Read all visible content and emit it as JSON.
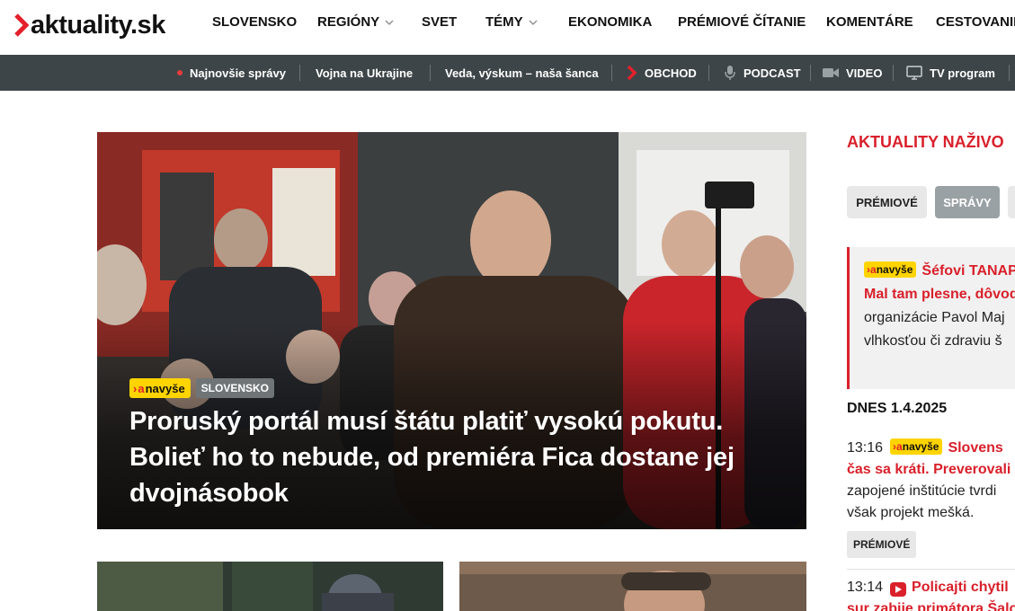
{
  "logo": {
    "text": "aktuality.sk"
  },
  "nav": {
    "items": [
      {
        "label": "SLOVENSKO",
        "dropdown": false
      },
      {
        "label": "REGIÓNY",
        "dropdown": true
      },
      {
        "label": "SVET",
        "dropdown": false
      },
      {
        "label": "TÉMY",
        "dropdown": true
      },
      {
        "label": "EKONOMIKA",
        "dropdown": false
      },
      {
        "label": "PRÉMIOVÉ ČÍTANIE",
        "dropdown": false
      },
      {
        "label": "KOMENTÁRE",
        "dropdown": false
      },
      {
        "label": "CESTOVANIE",
        "dropdown": false
      }
    ]
  },
  "subbar": {
    "items": [
      {
        "label": "Najnovšie správy",
        "icon": "red-dot-icon"
      },
      {
        "label": "Vojna na Ukrajine",
        "icon": ""
      },
      {
        "label": "Veda, výskum – naša šanca",
        "icon": ""
      },
      {
        "label": "OBCHOD",
        "icon": "chevron-logo-icon"
      },
      {
        "label": "PODCAST",
        "icon": "microphone-icon"
      },
      {
        "label": "VIDEO",
        "icon": "video-camera-icon"
      },
      {
        "label": "TV program",
        "icon": "tv-icon"
      }
    ]
  },
  "hero": {
    "tag_navyse": "navyše",
    "tag_category": "SLOVENSKO",
    "title": "Proruský portál musí štátu platiť vysokú pokutu. Bolieť ho to nebude, od premiéra Fica dostane jej dvojnásobok"
  },
  "sidebar": {
    "title": "AKTUALITY NAŽIVO",
    "tabs": [
      {
        "label": "PRÉMIOVÉ",
        "active": false
      },
      {
        "label": "SPRÁVY",
        "active": true
      },
      {
        "label": "",
        "active": false
      }
    ],
    "pinned": {
      "tag": "navyše",
      "headline_1": "Šéfovi TANAP",
      "headline_2": "Mal tam plesne, dôvod",
      "text_1": "organizácie Pavol Maj",
      "text_2": "vlhkosťou či zdraviu š"
    },
    "date": "DNES 1.4.2025",
    "feed": [
      {
        "time": "13:16",
        "tag": "navyše",
        "headline_1": "Slovens",
        "headline_2": "čas sa kráti. Preverovali s",
        "text_1": "zapojené inštitúcie tvrdi",
        "text_2": "však projekt mešká.",
        "badge": "PRÉMIOVÉ"
      },
      {
        "time": "13:14",
        "icon": "video-icon",
        "headline_1": "Policajti chytil",
        "headline_2": "sur zabije primátora Šalo"
      }
    ]
  },
  "colors": {
    "brand_red": "#d9202b",
    "subbar_bg": "#3e4548",
    "navyse_yellow": "#ffd400"
  }
}
